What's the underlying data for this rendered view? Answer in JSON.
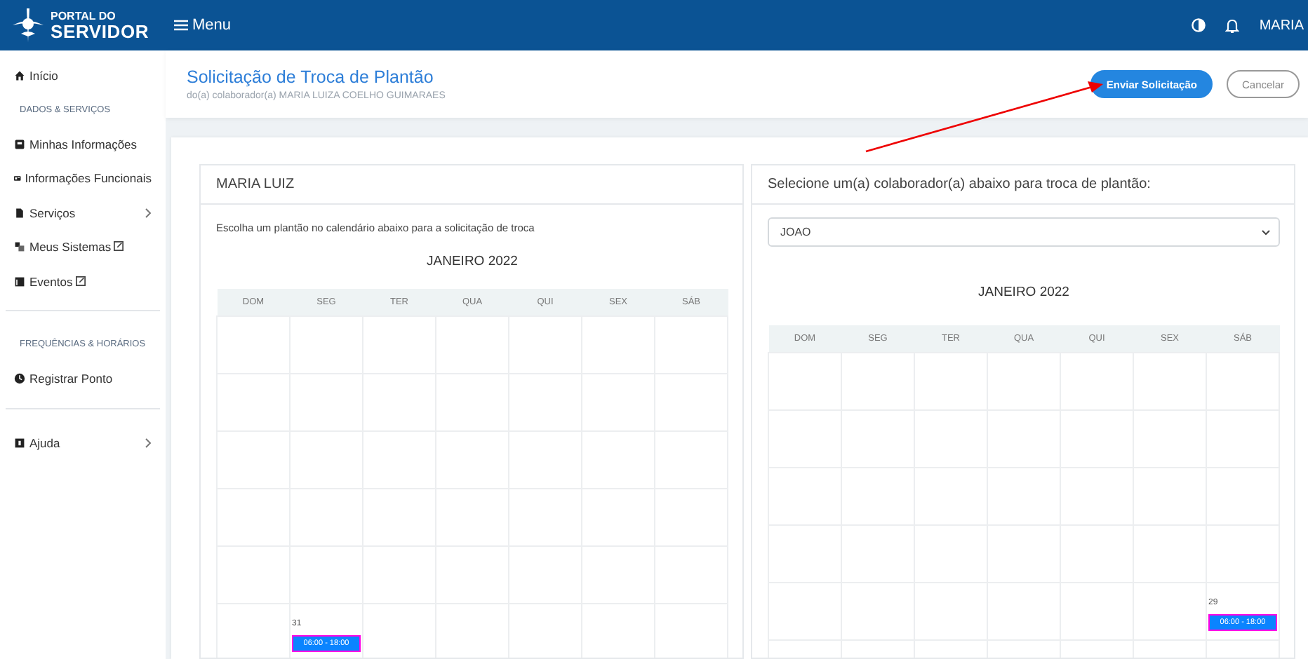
{
  "header": {
    "logo_top": "PORTAL DO",
    "logo_bottom": "SERVIDOR",
    "menu_label": "Menu",
    "user": "MARIA"
  },
  "sidebar": {
    "items": [
      {
        "kind": "link",
        "label": "Início",
        "has_submenu": false,
        "external": false
      },
      {
        "kind": "section",
        "label": "DADOS & SERVIÇOS"
      },
      {
        "kind": "link",
        "label": "Minhas Informações",
        "has_submenu": false,
        "external": false
      },
      {
        "kind": "link",
        "label": "Informações Funcionais",
        "has_submenu": false,
        "external": false
      },
      {
        "kind": "link",
        "label": "Serviços",
        "has_submenu": true,
        "external": false
      },
      {
        "kind": "link",
        "label": "Meus Sistemas",
        "has_submenu": false,
        "external": true
      },
      {
        "kind": "link",
        "label": "Eventos",
        "has_submenu": false,
        "external": true
      },
      {
        "kind": "divider"
      },
      {
        "kind": "section",
        "label": "FREQUÊNCIAS & HORÁRIOS"
      },
      {
        "kind": "link",
        "label": "Registrar Ponto",
        "has_submenu": false,
        "external": false
      },
      {
        "kind": "divider"
      },
      {
        "kind": "link",
        "label": "Ajuda",
        "has_submenu": true,
        "external": false
      }
    ]
  },
  "page": {
    "title": "Solicitação de Troca de Plantão",
    "subtitle": "do(a) colaborador(a) MARIA LUIZA COELHO GUIMARAES",
    "buttons": [
      {
        "label": "Enviar Solicitação",
        "kind": "primary"
      },
      {
        "label": "Cancelar",
        "kind": "outline"
      }
    ]
  },
  "panels": [
    {
      "title": "MARIA LUIZ",
      "instruction": "Escolha um plantão no calendário abaixo para a solicitação de troca",
      "calendar": {
        "month": "JANEIRO 2022",
        "weekdays": [
          "DOM",
          "SEG",
          "TER",
          "QUA",
          "QUI",
          "SEX",
          "SÁB"
        ],
        "shifts": [
          {
            "day": "31",
            "event": "06:00 - 18:00"
          }
        ]
      }
    },
    {
      "title": "Selecione um(a) colaborador(a) abaixo para troca de plantão:",
      "select_value": "JOAO",
      "calendar": {
        "month": "JANEIRO 2022",
        "weekdays": [
          "DOM",
          "SEG",
          "TER",
          "QUA",
          "QUI",
          "SEX",
          "SÁB"
        ],
        "shifts": [
          {
            "day": "29",
            "event": "06:00 - 18:00"
          }
        ]
      }
    }
  ]
}
